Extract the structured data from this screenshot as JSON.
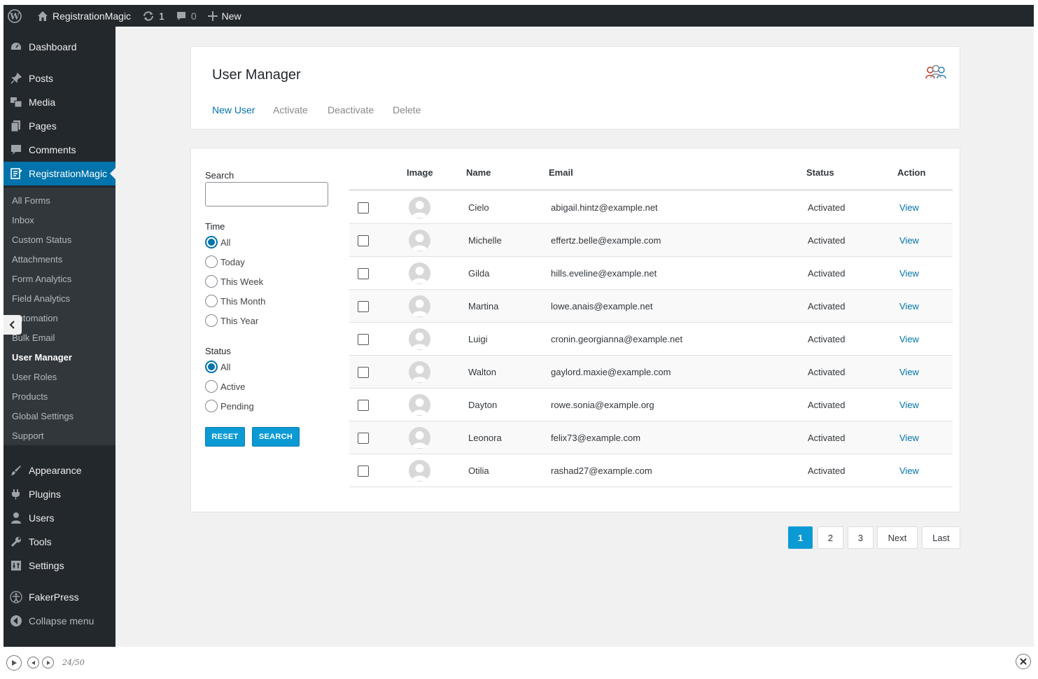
{
  "admin_bar": {
    "site_name": "RegistrationMagic",
    "updates_count": "1",
    "comments_count": "0",
    "new_label": "New"
  },
  "sidebar": {
    "top_items": [
      {
        "label": "Dashboard",
        "icon": "dashboard-icon"
      },
      {
        "label": "Posts",
        "icon": "pin-icon"
      },
      {
        "label": "Media",
        "icon": "media-icon"
      },
      {
        "label": "Pages",
        "icon": "pages-icon"
      },
      {
        "label": "Comments",
        "icon": "comment-icon"
      },
      {
        "label": "RegistrationMagic",
        "icon": "form-icon"
      }
    ],
    "submenu": [
      "All Forms",
      "Inbox",
      "Custom Status",
      "Attachments",
      "Form Analytics",
      "Field Analytics",
      "Automation",
      "Bulk Email",
      "User Manager",
      "User Roles",
      "Products",
      "Global Settings",
      "Support"
    ],
    "bottom_items": [
      {
        "label": "Appearance",
        "icon": "brush-icon"
      },
      {
        "label": "Plugins",
        "icon": "plugin-icon"
      },
      {
        "label": "Users",
        "icon": "user-icon"
      },
      {
        "label": "Tools",
        "icon": "wrench-icon"
      },
      {
        "label": "Settings",
        "icon": "settings-icon"
      },
      {
        "label": "FakerPress",
        "icon": "fakerpress-icon"
      },
      {
        "label": "Collapse menu",
        "icon": "collapse-icon"
      }
    ]
  },
  "header": {
    "title": "User Manager",
    "actions": {
      "new_user": "New User",
      "activate": "Activate",
      "deactivate": "Deactivate",
      "delete": "Delete"
    }
  },
  "filters": {
    "search_label": "Search",
    "search_value": "",
    "time_label": "Time",
    "time_options": [
      "All",
      "Today",
      "This Week",
      "This Month",
      "This Year"
    ],
    "time_selected": "All",
    "status_label": "Status",
    "status_options": [
      "All",
      "Active",
      "Pending"
    ],
    "status_selected": "All",
    "reset_label": "RESET",
    "search_button_label": "SEARCH"
  },
  "table": {
    "columns": [
      "Image",
      "Name",
      "Email",
      "Status",
      "Action"
    ],
    "rows": [
      {
        "name": "Cielo",
        "email": "abigail.hintz@example.net",
        "status": "Activated",
        "action": "View"
      },
      {
        "name": "Michelle",
        "email": "effertz.belle@example.com",
        "status": "Activated",
        "action": "View"
      },
      {
        "name": "Gilda",
        "email": "hills.eveline@example.net",
        "status": "Activated",
        "action": "View"
      },
      {
        "name": "Martina",
        "email": "lowe.anais@example.net",
        "status": "Activated",
        "action": "View"
      },
      {
        "name": "Luigi",
        "email": "cronin.georgianna@example.net",
        "status": "Activated",
        "action": "View"
      },
      {
        "name": "Walton",
        "email": "gaylord.maxie@example.com",
        "status": "Activated",
        "action": "View"
      },
      {
        "name": "Dayton",
        "email": "rowe.sonia@example.org",
        "status": "Activated",
        "action": "View"
      },
      {
        "name": "Leonora",
        "email": "felix73@example.com",
        "status": "Activated",
        "action": "View"
      },
      {
        "name": "Otilia",
        "email": "rashad27@example.com",
        "status": "Activated",
        "action": "View"
      }
    ]
  },
  "pagination": {
    "pages": [
      "1",
      "2",
      "3"
    ],
    "current": "1",
    "next_label": "Next",
    "last_label": "Last"
  },
  "player": {
    "counter": "24/50"
  },
  "colors": {
    "accent": "#0073aa",
    "button_blue": "#0c9ad5",
    "admin_dark": "#23282d"
  }
}
